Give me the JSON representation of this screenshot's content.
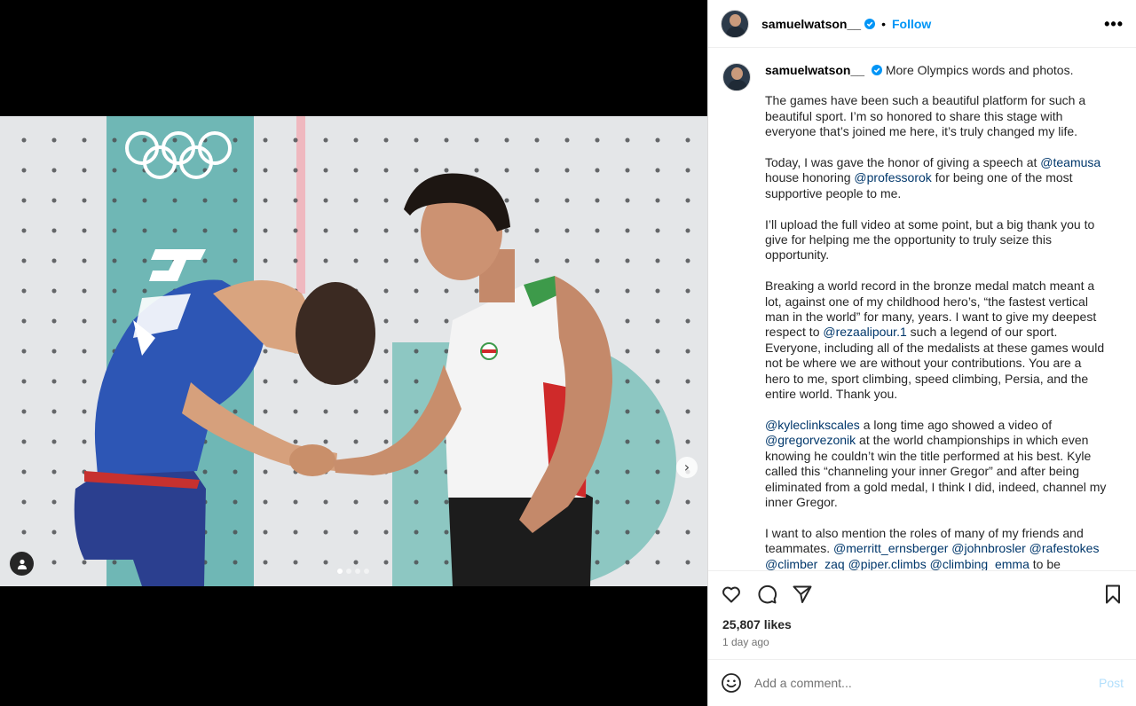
{
  "post": {
    "username": "samuelwatson__",
    "separator": "•",
    "follow_label": "Follow",
    "more_label": "•••",
    "carousel_next": "›",
    "carousel_count": 4,
    "carousel_active": 1
  },
  "caption": {
    "username": "samuelwatson__",
    "first_line": "More Olympics words and photos.",
    "p1": "The games have been such a beautiful platform for such a beautiful sport. I’m so honored to share this stage with everyone that’s joined me here, it’s truly changed my life.",
    "p2_a": "Today, I was gave the honor of giving a speech at ",
    "p2_m1": "@teamusa",
    "p2_b": " house honoring ",
    "p2_m2": "@professorok",
    "p2_c": " for being one of the most supportive people to me.",
    "p3": "I’ll upload the full video at some point, but a big thank you to give for helping me the opportunity to truly seize this opportunity.",
    "p4_a": "Breaking a world record in the bronze medal match meant a lot, against one of my childhood hero’s, “the fastest vertical man in the world” for many, years. I want to give my deepest respect to ",
    "p4_m1": "@rezaalipour.1",
    "p4_b": " such a legend of our sport. Everyone, including all of the medalists at these games would not be where we are without your contributions. You are a hero to me, sport climbing, speed climbing, Persia, and the entire world. Thank you.",
    "p5_m1": "@kyleclinkscales",
    "p5_a": " a long time ago showed a video of ",
    "p5_m2": "@gregorvezonik",
    "p5_b": " at the world championships in which even knowing he couldn’t win the title performed at his best. Kyle called this “channeling your inner Gregor” and after being eliminated from a gold medal, I think I did, indeed, channel my inner Gregor.",
    "p6_a": "I want to also mention the roles of many of my friends and teammates. ",
    "p6_m1": "@merritt_ernsberger",
    "p6_m2": "@johnbrosler",
    "p6_m3": "@rafestokes",
    "p6_m4": "@climber_zaq",
    "p6_m5": "@piper.climbs",
    "p6_m6": "@climbing_emma",
    "p6_b": " to be particular. What you’ve done for me is beyond words. I hope you see my"
  },
  "stats": {
    "likes": "25,807 likes",
    "time": "1 day ago"
  },
  "comment": {
    "placeholder": "Add a comment...",
    "post_label": "Post"
  },
  "colors": {
    "accent": "#0095f6",
    "mention": "#00376b",
    "verified": "#0095f6"
  },
  "icons": [
    "heart-icon",
    "comment-icon",
    "share-icon",
    "bookmark-icon",
    "emoji-icon",
    "verified-badge-icon",
    "user-tag-icon",
    "more-options-icon"
  ]
}
